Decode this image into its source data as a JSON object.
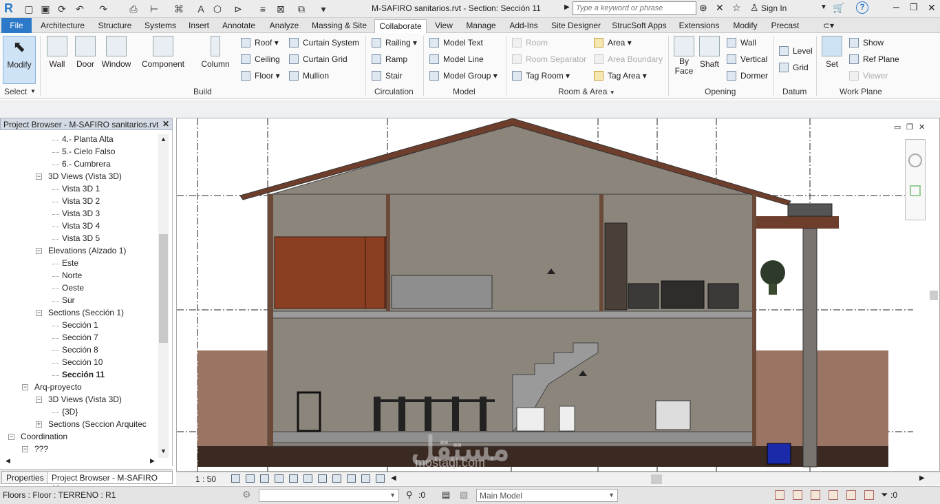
{
  "app": {
    "logo": "R",
    "title": "M-SAFIRO  sanitarios.rvt - Section: Sección 11"
  },
  "quick_access": [
    "open-icon",
    "save-icon",
    "sync-icon",
    "undo-icon",
    "redo-icon",
    "print-icon",
    "measure-icon",
    "tag-icon",
    "text-icon",
    "3d-view-icon",
    "section-icon",
    "thin-lines-icon",
    "close-hidden-icon",
    "switch-windows-icon",
    "customize-icon"
  ],
  "search": {
    "placeholder": "Type a keyword or phrase"
  },
  "account": {
    "signin": "Sign In"
  },
  "tabs": [
    {
      "label": "File"
    },
    {
      "label": "Architecture"
    },
    {
      "label": "Structure"
    },
    {
      "label": "Systems"
    },
    {
      "label": "Insert"
    },
    {
      "label": "Annotate"
    },
    {
      "label": "Analyze"
    },
    {
      "label": "Massing & Site"
    },
    {
      "label": "Collaborate"
    },
    {
      "label": "View"
    },
    {
      "label": "Manage"
    },
    {
      "label": "Add-Ins"
    },
    {
      "label": "Site Designer"
    },
    {
      "label": "StrucSoft Apps"
    },
    {
      "label": "Extensions"
    },
    {
      "label": "Modify"
    },
    {
      "label": "Precast"
    }
  ],
  "ribbon": {
    "select": {
      "modify": "Modify",
      "label": "Select"
    },
    "build": {
      "wall": "Wall",
      "door": "Door",
      "window": "Window",
      "component": "Component",
      "column": "Column",
      "roof": "Roof",
      "ceiling": "Ceiling",
      "floor": "Floor",
      "curtain_system": "Curtain System",
      "curtain_grid": "Curtain Grid",
      "mullion": "Mullion",
      "label": "Build"
    },
    "circulation": {
      "railing": "Railing",
      "ramp": "Ramp",
      "stair": "Stair",
      "label": "Circulation"
    },
    "model": {
      "text": "Model Text",
      "line": "Model Line",
      "group": "Model Group",
      "label": "Model"
    },
    "room_area": {
      "room": "Room",
      "separator": "Room Separator",
      "tag_room": "Tag Room",
      "area": "Area",
      "boundary": "Area Boundary",
      "tag_area": "Tag Area",
      "label": "Room & Area"
    },
    "opening": {
      "by_face": "By Face",
      "by_face_2": "Face",
      "shaft": "Shaft",
      "wall": "Wall",
      "vertical": "Vertical",
      "dormer": "Dormer",
      "label": "Opening"
    },
    "datum": {
      "level": "Level",
      "grid": "Grid",
      "label": "Datum"
    },
    "work_plane": {
      "set": "Set",
      "show": "Show",
      "ref_plane": "Ref Plane",
      "viewer": "Viewer",
      "label": "Work Plane"
    }
  },
  "project_browser": {
    "title": "Project Browser - M-SAFIRO  sanitarios.rvt",
    "rows": [
      {
        "text": "4.- Planta Alta",
        "indent": 5
      },
      {
        "text": "5.- Cielo Falso",
        "indent": 5
      },
      {
        "text": "6.- Cumbrera",
        "indent": 5
      },
      {
        "text": "3D Views (Vista 3D)",
        "indent": 4,
        "toggle": "−"
      },
      {
        "text": "Vista 3D 1",
        "indent": 5
      },
      {
        "text": "Vista 3D 2",
        "indent": 5
      },
      {
        "text": "Vista 3D 3",
        "indent": 5
      },
      {
        "text": "Vista 3D 4",
        "indent": 5
      },
      {
        "text": "Vista 3D 5",
        "indent": 5
      },
      {
        "text": "Elevations (Alzado 1)",
        "indent": 4,
        "toggle": "−"
      },
      {
        "text": "Este",
        "indent": 5
      },
      {
        "text": "Norte",
        "indent": 5
      },
      {
        "text": "Oeste",
        "indent": 5
      },
      {
        "text": "Sur",
        "indent": 5
      },
      {
        "text": "Sections (Sección  1)",
        "indent": 4,
        "toggle": "−"
      },
      {
        "text": "Sección 1",
        "indent": 5
      },
      {
        "text": "Sección 7",
        "indent": 5
      },
      {
        "text": "Sección 8",
        "indent": 5
      },
      {
        "text": "Sección 10",
        "indent": 5
      },
      {
        "text": "Sección 11",
        "indent": 5,
        "bold": true
      },
      {
        "text": "Arq-proyecto",
        "indent": 3,
        "toggle": "−"
      },
      {
        "text": "3D Views (Vista 3D)",
        "indent": 4,
        "toggle": "−"
      },
      {
        "text": "{3D}",
        "indent": 5
      },
      {
        "text": "Sections (Seccion Arquitec",
        "indent": 4,
        "toggle": "+"
      },
      {
        "text": "Coordination",
        "indent": 2,
        "toggle": "−"
      },
      {
        "text": "???",
        "indent": 3,
        "toggle": "−"
      }
    ]
  },
  "bottom_tabs": {
    "properties": "Properties",
    "browser": "Project Browser - M-SAFIRO  sa..."
  },
  "view": {
    "scale": "1 : 50",
    "watermark": "مستقل",
    "watermark_sub": "mostaql.com"
  },
  "status": {
    "text": "Floors : Floor : TERRENO : R1",
    "count": ":0",
    "workset": "Main Model",
    "filter": ":0"
  }
}
